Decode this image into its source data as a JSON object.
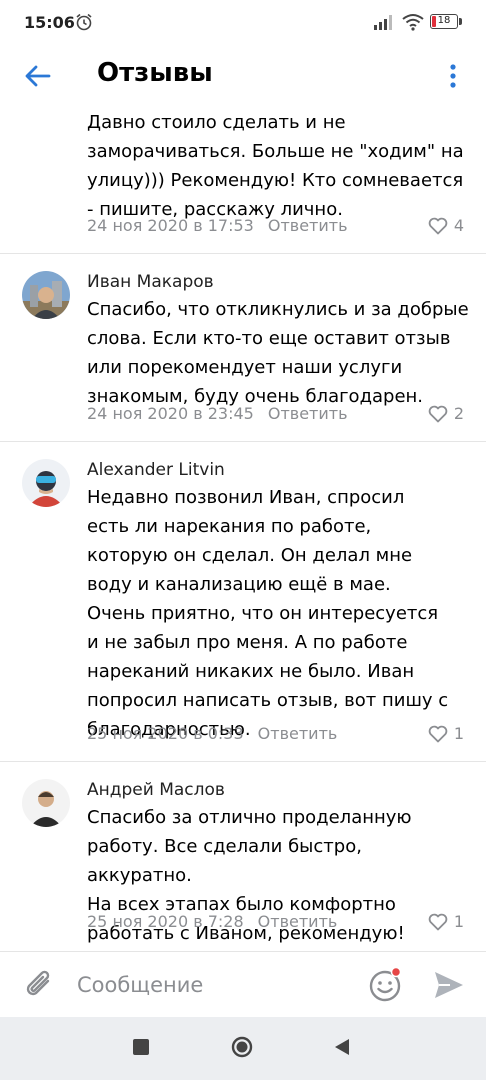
{
  "status_bar": {
    "time": "15:06",
    "battery": "18"
  },
  "header": {
    "title": "Отзывы"
  },
  "comments": [
    {
      "author": "",
      "text": "Давно стоило сделать и не\nзаморачиваться. Больше не \"ходим\" на\nулицу))) Рекомендую! Кто сомневается\n- пишите, расскажу лично.",
      "date": "24 ноя 2020 в 17:53",
      "reply": "Ответить",
      "likes": "4"
    },
    {
      "author": "Иван Макаров",
      "text": "Спасибо, что откликнулись и за добрые\nслова. Если кто-то еще оставит отзыв\nили порекомендует наши услуги\nзнакомым, буду очень благодарен.",
      "date": "24 ноя 2020 в 23:45",
      "reply": "Ответить",
      "likes": "2"
    },
    {
      "author": "Alexander Litvin",
      "text": "Недавно позвонил Иван, спросил\nесть ли нарекания по работе,\nкоторую он сделал. Он делал мне\nводу и канализацию ещё в мае.\nОчень приятно, что он интересуется\nи не забыл про меня. А по работе\nнареканий никаких не было. Иван\nпопросил написать отзыв, вот пишу с\nблагодарностью.",
      "date": "25 ноя 2020 в 0:33",
      "reply": "Ответить",
      "likes": "1"
    },
    {
      "author": "Андрей Маслов",
      "text": "Спасибо за отлично проделанную\nработу. Все сделали быстро, аккуратно.\nНа всех этапах было комфортно\nработать с Иваном, рекомендую!",
      "date": "25 ноя 2020 в 7:28",
      "reply": "Ответить",
      "likes": "1"
    }
  ],
  "composer": {
    "placeholder": "Сообщение"
  },
  "colors": {
    "accent": "#2b78d6",
    "meta": "#8b8d91",
    "badge": "#e64646"
  },
  "icons": [
    "alarm-icon",
    "signal-icon",
    "wifi-icon",
    "battery-icon",
    "back-arrow-icon",
    "more-vertical-icon",
    "heart-icon",
    "attach-icon",
    "emoji-icon",
    "send-icon",
    "nav-recents-icon",
    "nav-home-icon",
    "nav-back-icon"
  ]
}
